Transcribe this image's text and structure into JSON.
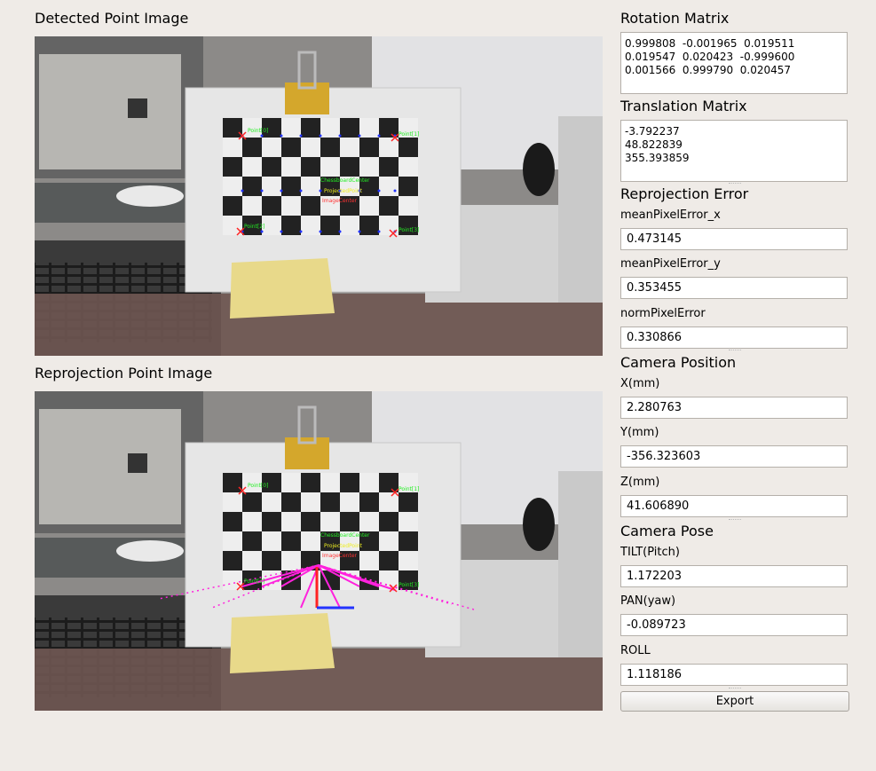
{
  "detected": {
    "title": "Detected Point Image"
  },
  "reprojection": {
    "title": "Reprojection Point Image"
  },
  "image_overlays": {
    "points": [
      "Point[0]",
      "Point[1]",
      "Point[2]",
      "Point[3]"
    ],
    "center_labels": [
      "ChessboardCenter",
      "ProjectedPoint",
      "ImageCenter"
    ]
  },
  "rotation": {
    "title": "Rotation Matrix",
    "value": "0.999808  -0.001965  0.019511\n0.019547  0.020423  -0.999600\n0.001566  0.999790  0.020457"
  },
  "translation": {
    "title": "Translation Matrix",
    "value": "-3.792237\n48.822839\n355.393859"
  },
  "reprojection_error": {
    "title": "Reprojection Error",
    "mean_x_label": "meanPixelError_x",
    "mean_x": "0.473145",
    "mean_y_label": "meanPixelError_y",
    "mean_y": "0.353455",
    "norm_label": "normPixelError",
    "norm": "0.330866"
  },
  "camera_position": {
    "title": "Camera Position",
    "x_label": "X(mm)",
    "x": "2.280763",
    "y_label": "Y(mm)",
    "y": "-356.323603",
    "z_label": "Z(mm)",
    "z": "41.606890"
  },
  "camera_pose": {
    "title": "Camera Pose",
    "tilt_label": "TILT(Pitch)",
    "tilt": "1.172203",
    "pan_label": "PAN(yaw)",
    "pan": "-0.089723",
    "roll_label": "ROLL",
    "roll": "1.118186"
  },
  "export_label": "Export"
}
